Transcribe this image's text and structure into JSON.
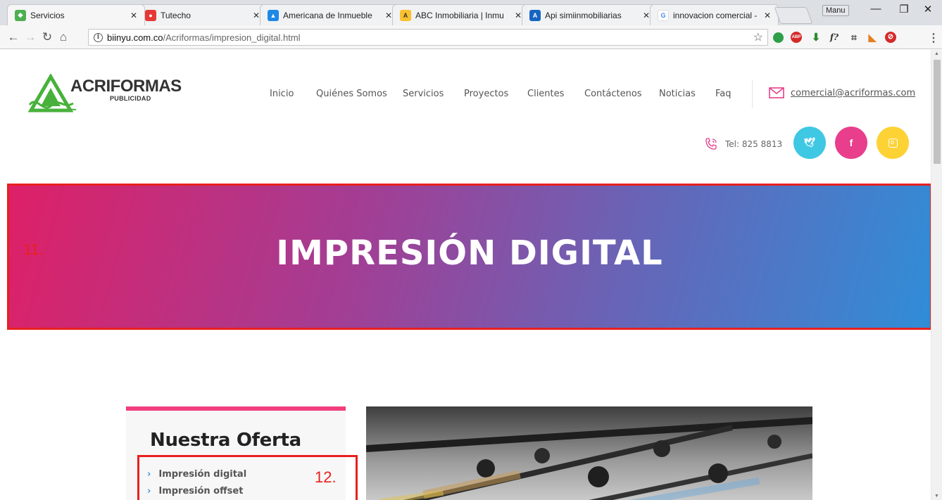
{
  "browser": {
    "tabs": [
      {
        "label": "Servicios",
        "color": "#4caf50"
      },
      {
        "label": "Tutecho",
        "color": "#e53935"
      },
      {
        "label": "Americana de Inmueble",
        "color": "#1e88e5"
      },
      {
        "label": "ABC Inmobiliaria | Inmu",
        "color": "#fbc02d"
      },
      {
        "label": "Api simiinmobiliarias",
        "color": "#1565c0"
      },
      {
        "label": "innovacion comercial - |",
        "color": "#4285f4"
      }
    ],
    "user_label": "Manu",
    "address": {
      "host": "biinyu.com.co",
      "path": "/Acriformas/impresion_digital.html"
    }
  },
  "site": {
    "logo": {
      "brand": "ACRIFORMAS",
      "sub": "PUBLICIDAD"
    },
    "nav": [
      "Inicio",
      "Quiénes Somos",
      "Servicios",
      "Proyectos",
      "Clientes",
      "Contáctenos",
      "Noticias",
      "Faq"
    ],
    "email": "comercial@acriformas.com",
    "phone": "Tel: 825 8813",
    "social": [
      {
        "name": "twitter",
        "glyph": "🐦",
        "color": "#3fc8e4"
      },
      {
        "name": "facebook",
        "glyph": "f",
        "color": "#e83e8c"
      },
      {
        "name": "instagram",
        "glyph": "◎",
        "color": "#fdd235"
      }
    ]
  },
  "hero": {
    "title": "IMPRESIÓN DIGITAL"
  },
  "annotations": {
    "hero": "11.",
    "sidebar": "12."
  },
  "sidebar": {
    "title": "Nuestra Oferta",
    "items": [
      "Impresión digital",
      "Impresión offset"
    ]
  },
  "colors": {
    "accent_pink": "#f23d7e",
    "accent_blue": "#3a94d8",
    "annotation_red": "#e8201e"
  }
}
